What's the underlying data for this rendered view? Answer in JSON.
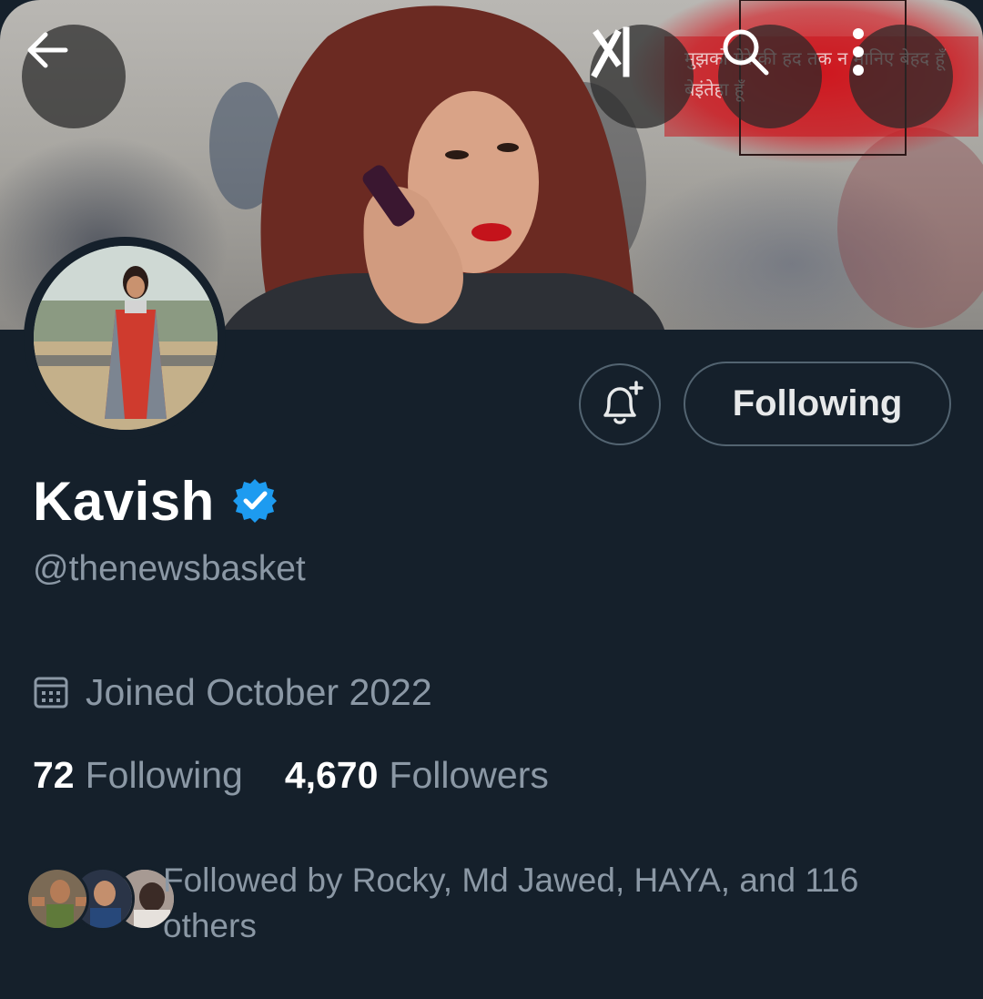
{
  "header": {
    "back_icon": "arrow-left-icon",
    "grok_icon": "grok-icon",
    "search_icon": "search-icon",
    "more_icon": "more-vertical-icon",
    "banner_text": "मुझको मेरे की हद तक न मानिए बेहद हूँ बेइंतेहा हूँ"
  },
  "profile": {
    "display_name": "Kavish",
    "verified_icon": "verified-badge-icon",
    "handle": "@thenewsbasket",
    "joined": "Joined October 2022",
    "following_count": "72",
    "following_label": "Following",
    "followers_count": "4,670",
    "followers_label": "Followers",
    "followed_by": "Followed by Rocky, Md Jawed, HAYA, and 116 others"
  },
  "actions": {
    "notify_icon": "bell-plus-icon",
    "following_button": "Following"
  },
  "colors": {
    "background": "#15202b",
    "muted_text": "#8b98a5",
    "border": "#536471",
    "verified": "#1d9bf0"
  }
}
